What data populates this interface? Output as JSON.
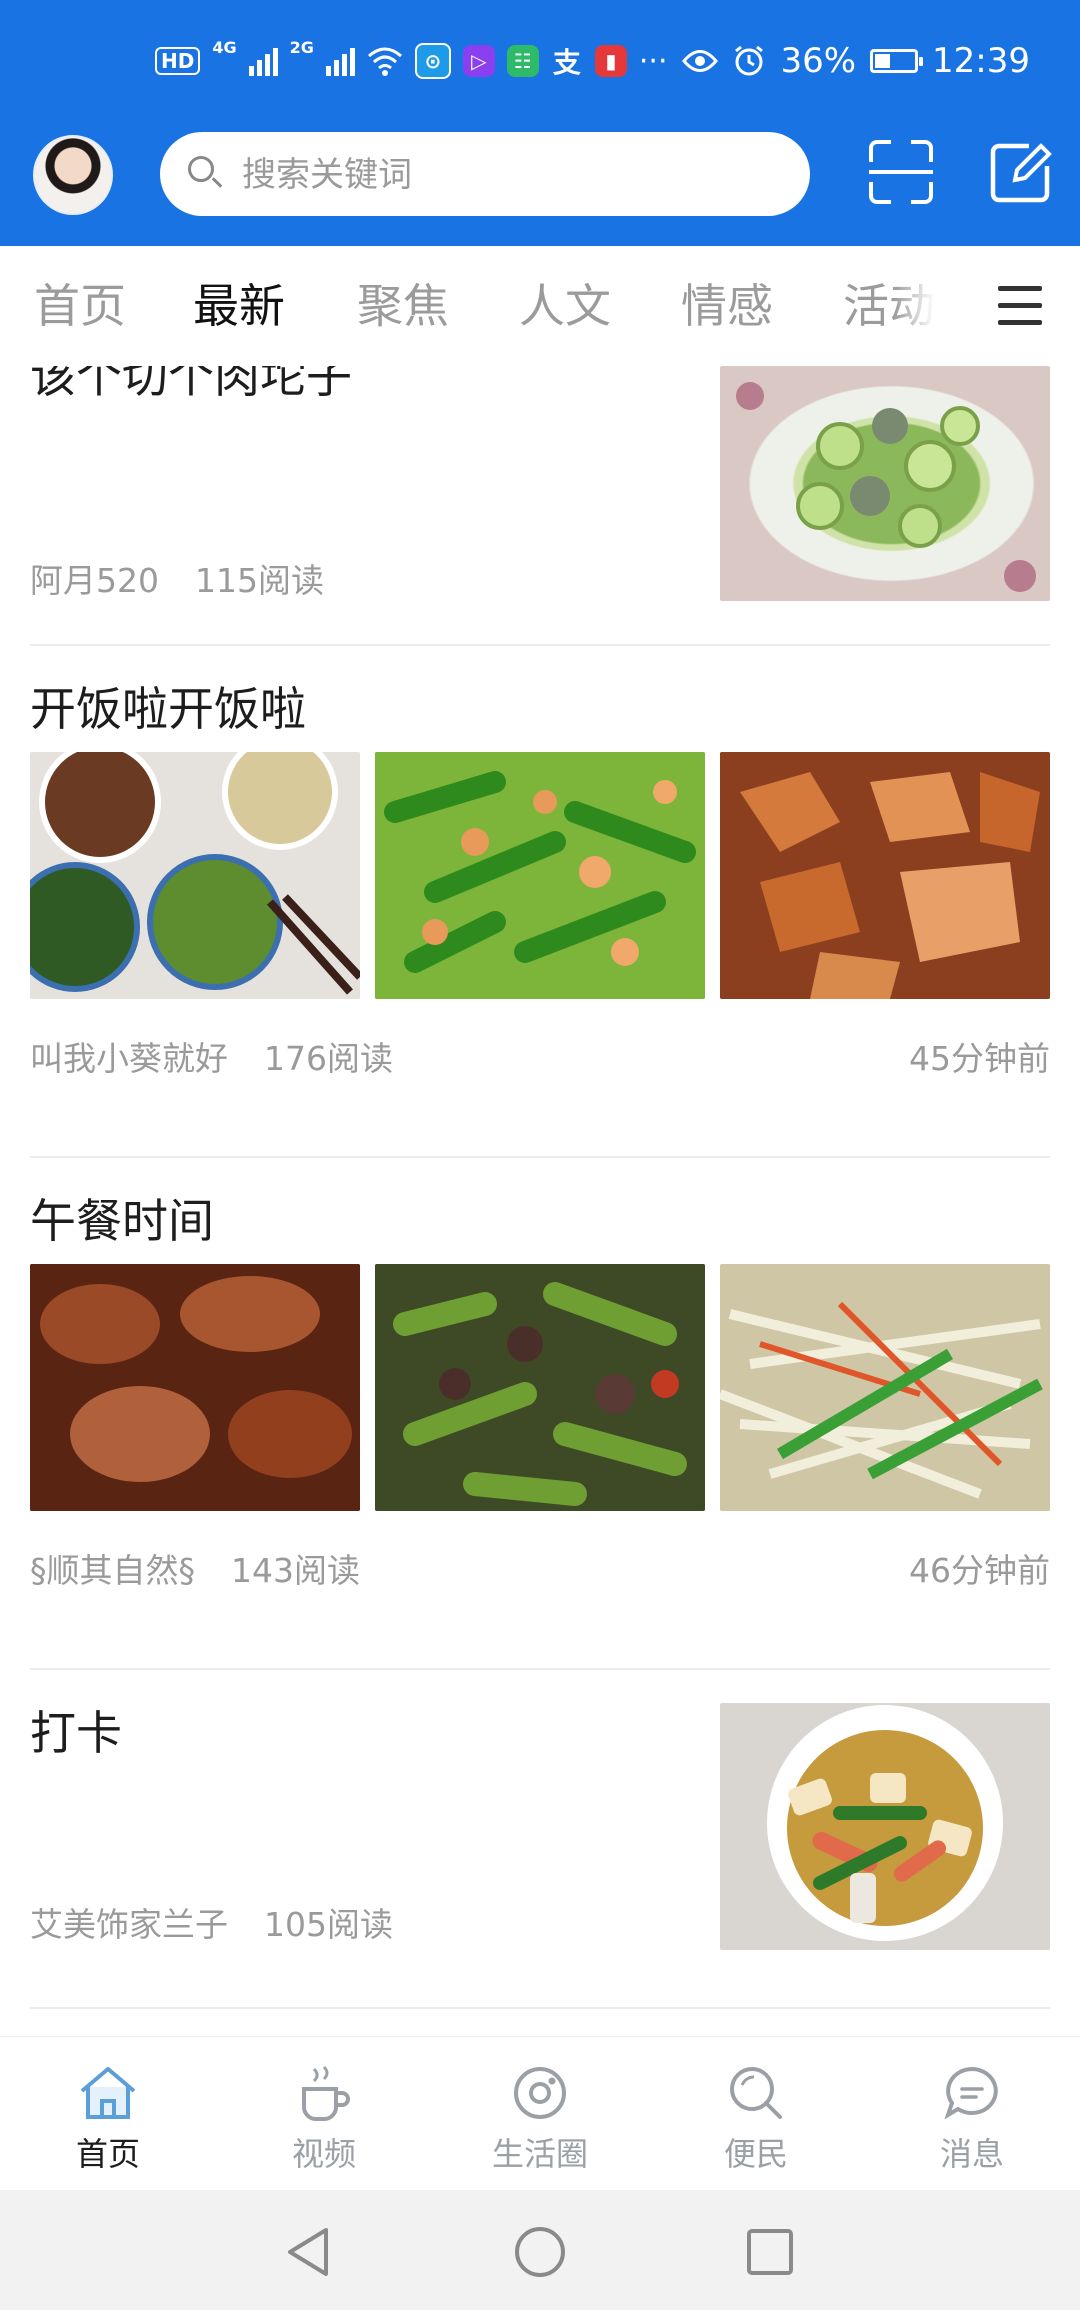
{
  "status_bar": {
    "hd_tag": "HD",
    "net1": "4G",
    "net2": "2G",
    "battery": "36%",
    "time": "12:39",
    "more": "···"
  },
  "header": {
    "search_placeholder": "搜索关键词"
  },
  "tabs": [
    {
      "label": "首页",
      "active": false
    },
    {
      "label": "最新",
      "active": true
    },
    {
      "label": "聚焦",
      "active": false
    },
    {
      "label": "人文",
      "active": false
    },
    {
      "label": "情感",
      "active": false
    },
    {
      "label": "活动",
      "active": false
    }
  ],
  "articles": [
    {
      "title": "该个切个肉坨子",
      "author": "阿月520",
      "reads": "115阅读",
      "time": ""
    },
    {
      "title": "开饭啦开饭啦",
      "author": "叫我小葵就好",
      "reads": "176阅读",
      "time": "45分钟前"
    },
    {
      "title": "午餐时间",
      "author": "§顺其自然§",
      "reads": "143阅读",
      "time": "46分钟前"
    },
    {
      "title": "打卡",
      "author": "艾美饰家兰子",
      "reads": "105阅读",
      "time": ""
    }
  ],
  "bottom_nav": [
    {
      "label": "首页",
      "icon": "home-icon",
      "active": true
    },
    {
      "label": "视频",
      "icon": "coffee-cup-icon",
      "active": false
    },
    {
      "label": "生活圈",
      "icon": "circle-icon",
      "active": false
    },
    {
      "label": "便民",
      "icon": "search-icon",
      "active": false
    },
    {
      "label": "消息",
      "icon": "message-icon",
      "active": false
    }
  ],
  "colors": {
    "header_blue": "#1a73e3",
    "tab_indicator": "#34a853",
    "nav_icon": "#9aa0a6",
    "nav_active_icon": "#5a9fd8"
  }
}
